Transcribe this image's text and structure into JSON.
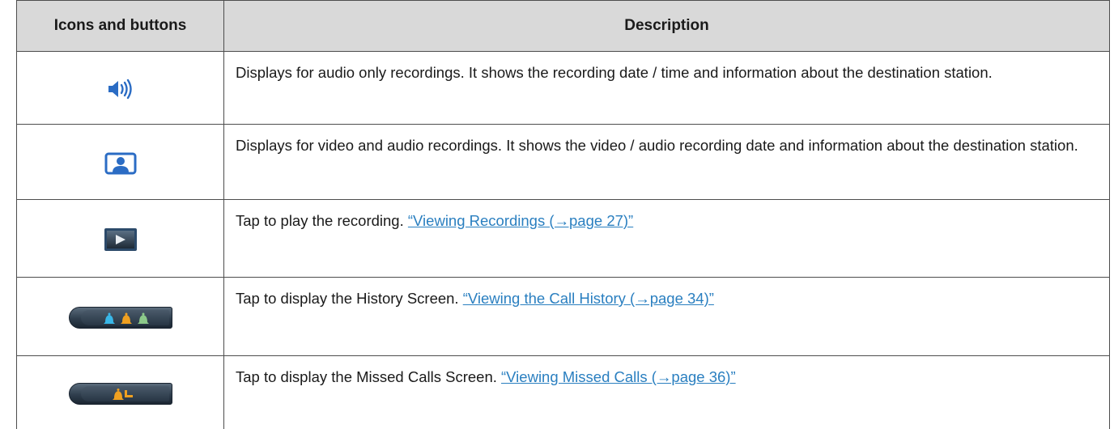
{
  "table": {
    "headers": [
      "Icons and buttons",
      "Description"
    ],
    "rows": [
      {
        "icon": "speaker-audio-icon",
        "text": "Displays for audio only recordings. It shows the recording date / time and information about the destination station.",
        "link": ""
      },
      {
        "icon": "video-person-icon",
        "text": "Displays for video and audio recordings. It shows the video / audio recording date and information about the destination station.",
        "link": ""
      },
      {
        "icon": "play-button-icon",
        "text": "Tap to play the recording. ",
        "link": "“Viewing Recordings (→page 27)”"
      },
      {
        "icon": "history-bells-button-icon",
        "text": "Tap to display the History Screen. ",
        "link": "“Viewing the Call History (→page 34)”"
      },
      {
        "icon": "missed-calls-button-icon",
        "text": "Tap to display the Missed Calls Screen. ",
        "link": "“Viewing Missed Calls (→page 36)”"
      }
    ]
  },
  "colors": {
    "header_bg": "#d9d9d9",
    "link": "#2a7fc0",
    "icon_blue": "#2b6cc4",
    "bell_cyan": "#39b7e8",
    "bell_orange": "#f0a020",
    "bell_green": "#8cc98a"
  }
}
